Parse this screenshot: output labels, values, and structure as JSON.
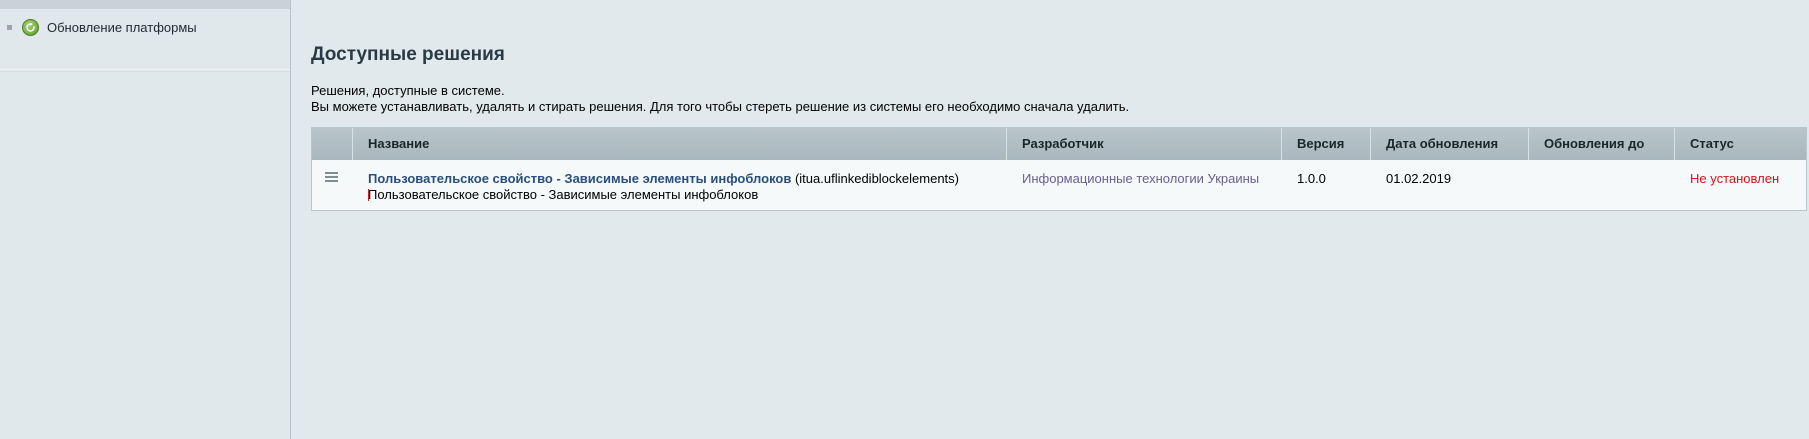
{
  "sidebar": {
    "items": [
      {
        "label": "Обновление платформы",
        "icon": "update-icon"
      }
    ]
  },
  "page": {
    "title": "Доступные решения",
    "description_line1": "Решения, доступные в системе.",
    "description_line2": "Вы можете устанавливать, удалять и стирать решения. Для того чтобы стереть решение из системы его необходимо сначала удалить."
  },
  "table": {
    "headers": [
      "Название",
      "Разработчик",
      "Версия",
      "Дата обновления",
      "Обновления до",
      "Статус"
    ],
    "rows": [
      {
        "name": "Пользовательское свойство - Зависимые элементы инфоблоков",
        "code": "(itua.uflinkediblockelements)",
        "description": "Пользовательское свойство - Зависимые элементы инфоблоков",
        "developer": "Информационные технологии Украины",
        "version": "1.0.0",
        "date": "01.02.2019",
        "updates_to": "",
        "status": "Не установлен"
      }
    ]
  },
  "colors": {
    "link": "#2a4f7c",
    "developer_link": "#6b5f8c",
    "status_not_installed": "#e0101a",
    "header_bg": "#b4c1c7",
    "page_bg": "#e2e9ec"
  }
}
